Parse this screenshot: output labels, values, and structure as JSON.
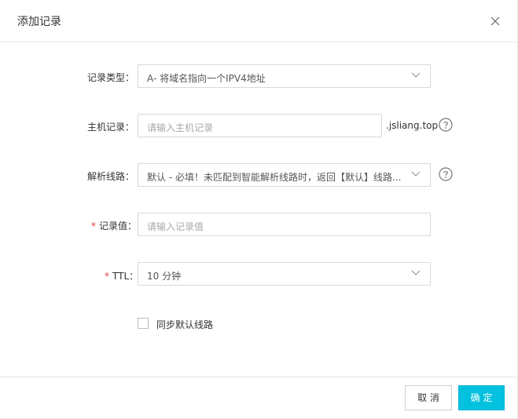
{
  "dialog": {
    "title": "添加记录",
    "close_icon": "close-icon"
  },
  "form": {
    "record_type": {
      "label": "记录类型：",
      "value": "A- 将域名指向一个IPV4地址"
    },
    "host_record": {
      "label": "主机记录：",
      "placeholder": "请输入主机记录",
      "suffix": ".jsliang.top"
    },
    "resolve_line": {
      "label": "解析线路：",
      "value": "默认 - 必填！未匹配到智能解析线路时，返回【默认】线路..."
    },
    "record_value": {
      "required_mark": "*",
      "label": "记录值：",
      "placeholder": "请输入记录值"
    },
    "ttl": {
      "required_mark": "*",
      "label": "TTL：",
      "value": "10 分钟"
    },
    "sync_default": {
      "label": "同步默认线路",
      "checked": false
    }
  },
  "footer": {
    "cancel_label": "取 消",
    "ok_label": "确 定"
  },
  "colors": {
    "primary": "#00c1de",
    "required": "#e4393c"
  }
}
